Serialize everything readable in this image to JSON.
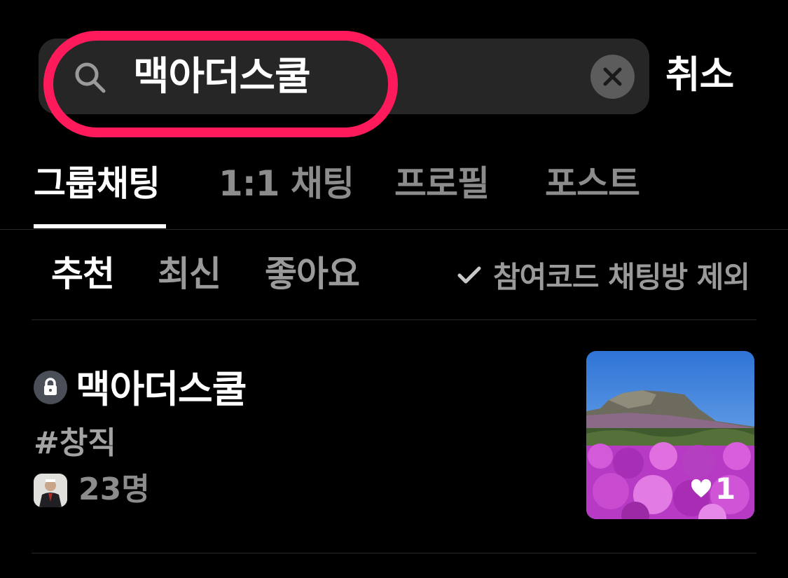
{
  "search": {
    "query": "맥아더스쿨",
    "cancel_label": "취소"
  },
  "tabs": [
    {
      "label": "그룹채팅",
      "active": true
    },
    {
      "label": "1:1 채팅",
      "active": false
    },
    {
      "label": "프로필",
      "active": false
    },
    {
      "label": "포스트",
      "active": false
    }
  ],
  "sort": {
    "options": [
      {
        "label": "추천",
        "active": true
      },
      {
        "label": "최신",
        "active": false
      },
      {
        "label": "좋아요",
        "active": false
      }
    ],
    "exclude_filter": {
      "label": "참여코드 채팅방 제외",
      "checked": true
    }
  },
  "results": [
    {
      "title": "맥아더스쿨",
      "tag": "#창직",
      "member_count": "23명",
      "like_count": "1",
      "locked": true,
      "icon": "lock-icon"
    }
  ],
  "colors": {
    "background": "#000000",
    "search_bg": "#262626",
    "highlight": "#ff1a5b",
    "inactive_text": "#8c8c8c"
  }
}
